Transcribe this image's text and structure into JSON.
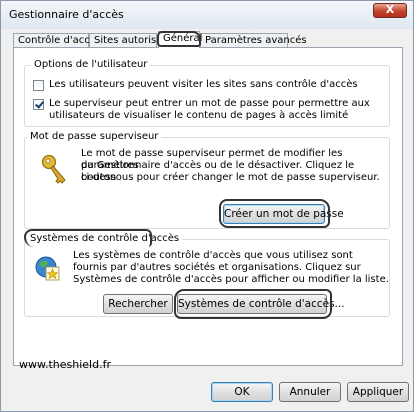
{
  "window": {
    "title": "Gestionnaire d'accès",
    "close_label": "X"
  },
  "tabs": [
    {
      "label": "Contrôle d'accès"
    },
    {
      "label": "Sites autorisés"
    },
    {
      "label": "Général"
    },
    {
      "label": "Paramètres avancés"
    }
  ],
  "user_options": {
    "title": "Options de l'utilisateur",
    "option1": {
      "checked": false,
      "label": "Les utilisateurs peuvent visiter les sites sans contrôle d'accès"
    },
    "option2": {
      "checked": true,
      "line1": "Le superviseur peut entrer un mot de passe pour permettre aux",
      "line2": "utilisateurs de visualiser le contenu de pages à accès limité"
    }
  },
  "supervisor_password": {
    "title": "Mot de passe superviseur",
    "lines": [
      "Le mot de passe superviseur permet de modifier les paramètres",
      "du Gestionnaire d'accès ou de le désactiver. Cliquez le bouton",
      "ci-dessous pour créer changer le mot de passe superviseur."
    ],
    "button": "Créer un mot de passe"
  },
  "access_systems": {
    "title": "Systèmes de contrôle d'accès",
    "lines": [
      "Les systèmes de contrôle d'accès que vous utilisez sont",
      "fournis par d'autres sociétés et organisations. Cliquez sur",
      "Systèmes de contrôle d'accès pour afficher ou modifier la liste."
    ],
    "search_button": "Rechercher",
    "systems_button": "Systèmes de contrôle d'accès..."
  },
  "footer": {
    "url": "www.theshield.fr"
  },
  "buttons": {
    "ok": "OK",
    "cancel": "Annuler",
    "apply": "Appliquer"
  }
}
